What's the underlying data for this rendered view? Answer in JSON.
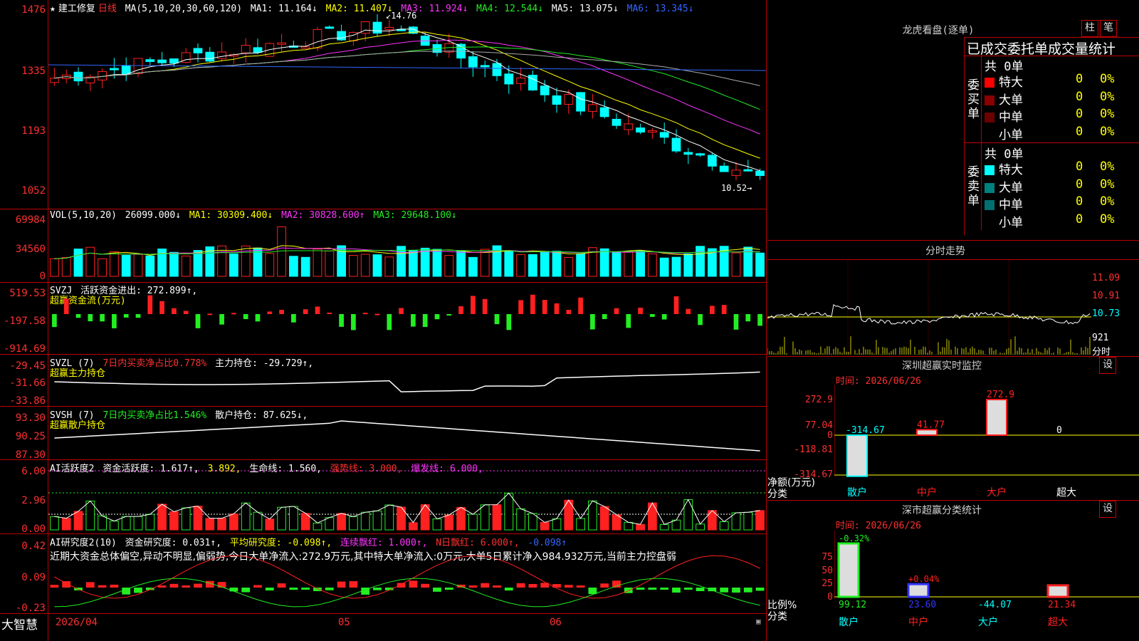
{
  "chart_header": {
    "star": "★",
    "name": "建工修复",
    "period": "日线",
    "ma_label": "MA(5,10,20,30,60,120)",
    "ma1": "MA1: 11.164↓",
    "ma2": "MA2: 11.407↓",
    "ma3": "MA3: 11.924↓",
    "ma4": "MA4: 12.544↓",
    "ma5": "MA5: 13.075↓",
    "ma6": "MA6: 13.345↓",
    "high_marker": "14.76",
    "low_marker": "10.52"
  },
  "price_axis": [
    "1476",
    "1335",
    "1193",
    "1052"
  ],
  "vol": {
    "label": "VOL(5,10,20)",
    "value": "26099.000↓",
    "ma1": "MA1: 30309.400↓",
    "ma2": "MA2: 30828.600↑",
    "ma3": "MA3: 29648.100↓",
    "axis": [
      "69984",
      "34560",
      "0"
    ]
  },
  "svzj": {
    "name": "SVZJ",
    "line1": "活跃资金进出: 272.899↑,",
    "line2": "超赢资金流(万元)",
    "axis": [
      "519.53",
      "-197.58",
      "-914.69"
    ]
  },
  "svzl": {
    "name": "SVZL (7)",
    "pct": "7日内买卖净占比0.778%",
    "hold": "主力持仓: -29.729↑,",
    "line2": "超赢主力持仓",
    "axis": [
      "-29.45",
      "-31.66",
      "-33.86"
    ]
  },
  "svsh": {
    "name": "SVSH (7)",
    "pct": "7日内买卖净占比1.546%",
    "hold": "散户持仓: 87.625↓,",
    "line2": "超赢散户持仓",
    "axis": [
      "93.30",
      "90.25",
      "87.30"
    ]
  },
  "ai_act": {
    "name": "AI活跃度2",
    "v1": "资金活跃度: 1.617↑,",
    "v2": "3.892,",
    "v3": "生命线: 1.560,",
    "v4": "强势线: 3.000,",
    "v5": "爆发线: 6.000,",
    "axis": [
      "6.00",
      "2.96",
      "0.00"
    ]
  },
  "ai_res": {
    "name": "AI研究度2(10)",
    "v1": "资金研究度: 0.031↑,",
    "v2": "平均研究度: -0.098↑,",
    "v3": "连续飘红: 1.000↑,",
    "v4": "N日飘红: 6.000↑,",
    "v5": "-0.098↑",
    "summary": "近期大资金总体偏空,异动不明显,偏弱势,今日大单净流入:272.9万元,其中特大单净流入:0万元,大单5日累计净入984.932万元,当前主力控盘弱",
    "axis": [
      "0.42",
      "0.09",
      "-0.23"
    ]
  },
  "bottom": {
    "brand": "大智慧",
    "date": "2026/04",
    "m05": "05",
    "m06": "06"
  },
  "dragon": {
    "title": "龙虎看盘(逐单)",
    "btn1": "柱",
    "btn2": "笔",
    "head": "已成交委托单成交量统计",
    "buy_label": "委买单",
    "sell_label": "委卖单",
    "buy_total": "共 0单",
    "sell_total": "共 0单",
    "rows": [
      {
        "name": "特大",
        "count": "0",
        "pct": "0%"
      },
      {
        "name": "大单",
        "count": "0",
        "pct": "0%"
      },
      {
        "name": "中单",
        "count": "0",
        "pct": "0%"
      },
      {
        "name": "小单",
        "count": "0",
        "pct": "0%"
      }
    ],
    "buy_colors": [
      "#ff0000",
      "#8b0000",
      "#6b0000",
      "#000000"
    ],
    "sell_colors": [
      "#00ffff",
      "#008080",
      "#007070",
      "#000000"
    ]
  },
  "intraday": {
    "title": "分时走势",
    "p1": "11.09",
    "p2": "10.91",
    "p3": "10.73",
    "vol": "921",
    "unit": "分时"
  },
  "monitor": {
    "title": "深圳超赢实时监控",
    "btn": "设",
    "time": "时间: 2026/06/26",
    "axis": [
      "272.9",
      "77.04",
      "0",
      "-118.81",
      "-314.67"
    ],
    "unit": "净额(万元)",
    "cat": "分类",
    "bars": [
      {
        "name": "散户",
        "value": -314.67,
        "label": "-314.67"
      },
      {
        "name": "中户",
        "value": 41.77,
        "label": "41.77"
      },
      {
        "name": "大户",
        "value": 272.9,
        "label": "272.9"
      },
      {
        "name": "超大",
        "value": 0,
        "label": "0"
      }
    ]
  },
  "classify": {
    "title": "深市超赢分类统计",
    "btn": "设",
    "time": "时间: 2026/06/26",
    "axis": [
      "75",
      "50",
      "25",
      "0"
    ],
    "unit": "比例%",
    "cat": "分类",
    "bars": [
      {
        "name": "散户",
        "value": 99.12,
        "label": "99.12",
        "change": "-0.32%"
      },
      {
        "name": "中户",
        "value": 23.6,
        "label": "23.60",
        "change": "+0.04%"
      },
      {
        "name": "大户",
        "value": -44.07,
        "label": "-44.07",
        "change": ""
      },
      {
        "name": "超大",
        "value": 21.34,
        "label": "21.34",
        "change": ""
      }
    ]
  }
}
